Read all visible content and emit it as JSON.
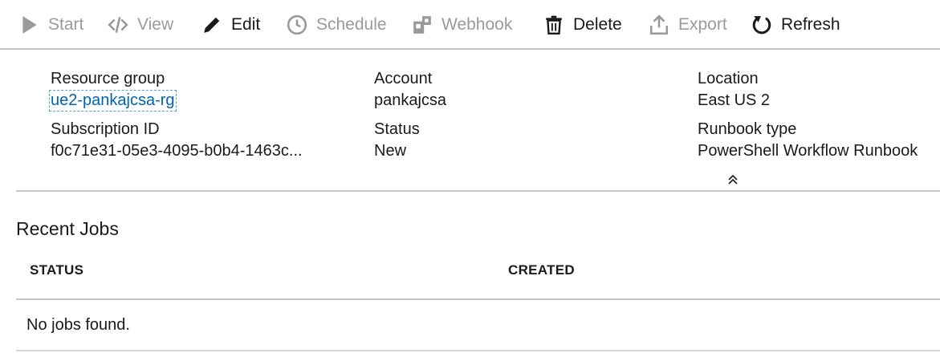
{
  "toolbar": {
    "items": [
      {
        "label": "Start",
        "icon": "play-icon",
        "enabled": false
      },
      {
        "label": "View",
        "icon": "code-icon",
        "enabled": false
      },
      {
        "label": "Edit",
        "icon": "pencil-icon",
        "enabled": true
      },
      {
        "label": "Schedule",
        "icon": "clock-icon",
        "enabled": false
      },
      {
        "label": "Webhook",
        "icon": "webhook-icon",
        "enabled": false
      },
      {
        "label": "Delete",
        "icon": "trash-icon",
        "enabled": true
      },
      {
        "label": "Export",
        "icon": "export-icon",
        "enabled": false
      },
      {
        "label": "Refresh",
        "icon": "refresh-icon",
        "enabled": true
      }
    ]
  },
  "essentials": {
    "resource_group": {
      "label": "Resource group",
      "value": "ue2-pankajcsa-rg"
    },
    "account": {
      "label": "Account",
      "value": "pankajcsa"
    },
    "location": {
      "label": "Location",
      "value": "East US 2"
    },
    "subscription_id": {
      "label": "Subscription ID",
      "value": "f0c71e31-05e3-4095-b0b4-1463c..."
    },
    "status": {
      "label": "Status",
      "value": "New"
    },
    "runbook_type": {
      "label": "Runbook type",
      "value": "PowerShell Workflow Runbook"
    },
    "collapse_icon": "double-chevron-up-icon"
  },
  "recent_jobs": {
    "title": "Recent Jobs",
    "columns": [
      "STATUS",
      "CREATED"
    ],
    "empty_message": "No jobs found."
  },
  "colors": {
    "disabled_text": "#9a9a9a",
    "enabled_text": "#1a1a1a",
    "link": "#0063b1",
    "divider": "#c8c8c8"
  }
}
